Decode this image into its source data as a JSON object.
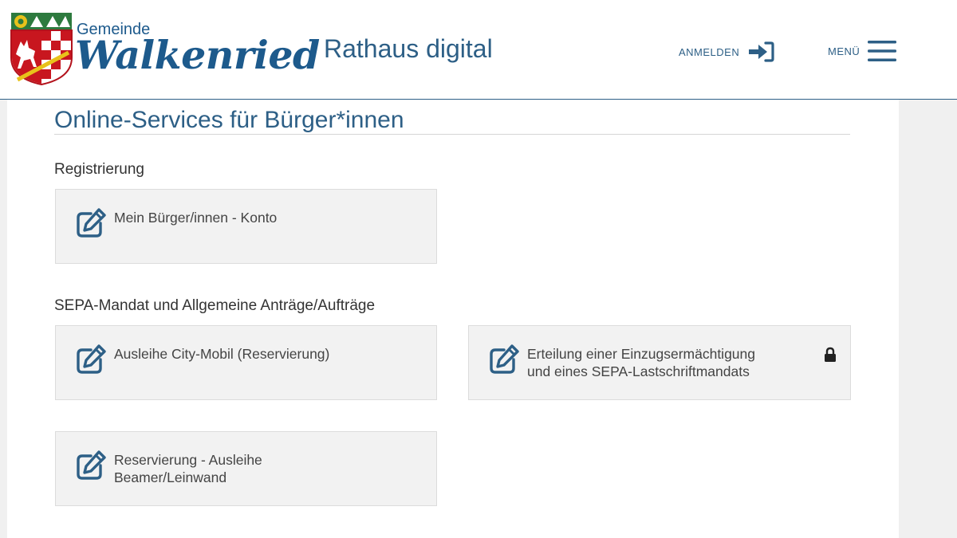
{
  "header": {
    "logo_small": "Gemeinde",
    "logo_big": "Walkenried",
    "site_title": "Rathaus digital",
    "login_label": "ANMELDEN",
    "login_icon": "sign-in-icon",
    "menu_label": "MENÜ",
    "menu_icon": "hamburger-icon"
  },
  "main": {
    "page_title": "Online-Services für Bürger*innen",
    "sections": [
      {
        "heading": "Registrierung",
        "cards": [
          {
            "line1": "Mein Bürger/innen - Konto",
            "line2": "",
            "locked": false
          }
        ]
      },
      {
        "heading": "SEPA-Mandat und Allgemeine Anträge/Aufträge",
        "cards": [
          {
            "line1": "Ausleihe City-Mobil (Reservierung)",
            "line2": "",
            "locked": false
          },
          {
            "line1": "Erteilung einer Einzugsermächtigung",
            "line2": "und eines SEPA-Lastschriftmandats",
            "locked": true
          },
          {
            "line1": "Reservierung - Ausleihe",
            "line2": "Beamer/Leinwand",
            "locked": false
          }
        ]
      }
    ]
  },
  "colors": {
    "brand_blue": "#2d5f86",
    "card_bg": "#f2f2f2"
  }
}
